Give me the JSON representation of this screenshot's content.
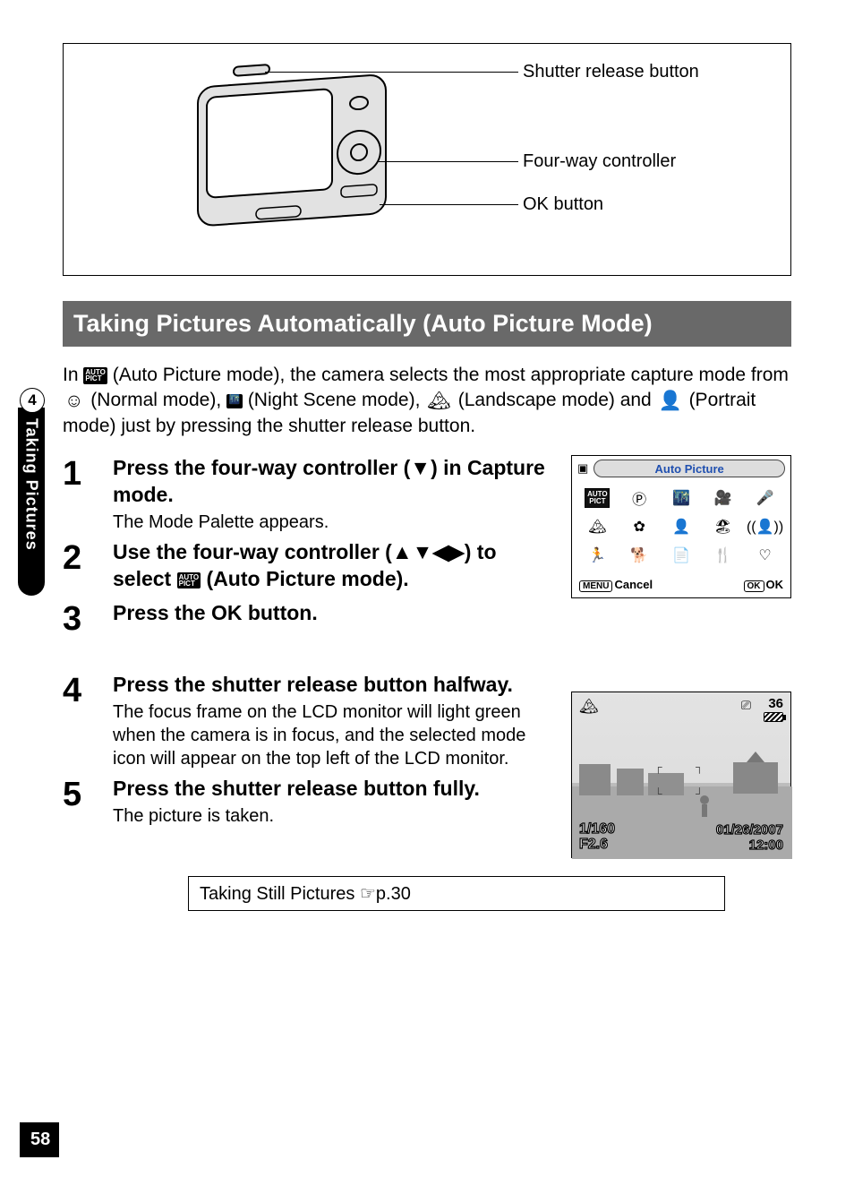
{
  "page_number": "58",
  "side_tab": {
    "chapter_number": "4",
    "chapter_title": "Taking Pictures"
  },
  "diagram": {
    "labels": {
      "shutter": "Shutter release button",
      "fourway": "Four-way controller",
      "ok": "OK button"
    }
  },
  "section_heading": "Taking Pictures Automatically (Auto Picture Mode)",
  "intro": {
    "t1": "In ",
    "t2": " (Auto Picture mode), the camera selects the most appropriate capture mode from ",
    "t3": " (Normal mode), ",
    "t4": " (Night Scene mode), ",
    "t5": " (Landscape mode) and ",
    "t6": " (Portrait mode) just by pressing the shutter release button."
  },
  "steps": [
    {
      "num": "1",
      "title": "Press the four-way controller (▼) in Capture mode.",
      "desc": "The Mode Palette appears."
    },
    {
      "num": "2",
      "title_a": "Use the four-way controller (▲▼◀▶) to select ",
      "title_b": "  (Auto Picture mode).",
      "desc": ""
    },
    {
      "num": "3",
      "title": "Press the OK button.",
      "desc": ""
    },
    {
      "num": "4",
      "title": "Press the shutter release button halfway.",
      "desc": "The focus frame on the LCD monitor will light green when the camera is in focus, and the selected mode icon will appear on the top left of the LCD monitor."
    },
    {
      "num": "5",
      "title": "Press the shutter release button fully.",
      "desc": "The picture is taken."
    }
  ],
  "palette": {
    "camera_icon": "camera-icon",
    "title": "Auto Picture",
    "selected_line1": "AUTO",
    "selected_line2": "PICT",
    "menu_key": "MENU",
    "cancel": "Cancel",
    "ok_key": "OK",
    "ok": "OK"
  },
  "photo_overlay": {
    "count": "36",
    "shutter": "1/160",
    "aperture": "F2.6",
    "date": "01/26/2007",
    "time": "12:00"
  },
  "footer_box": {
    "text": "Taking Still Pictures ",
    "ref": "☞p.30"
  }
}
